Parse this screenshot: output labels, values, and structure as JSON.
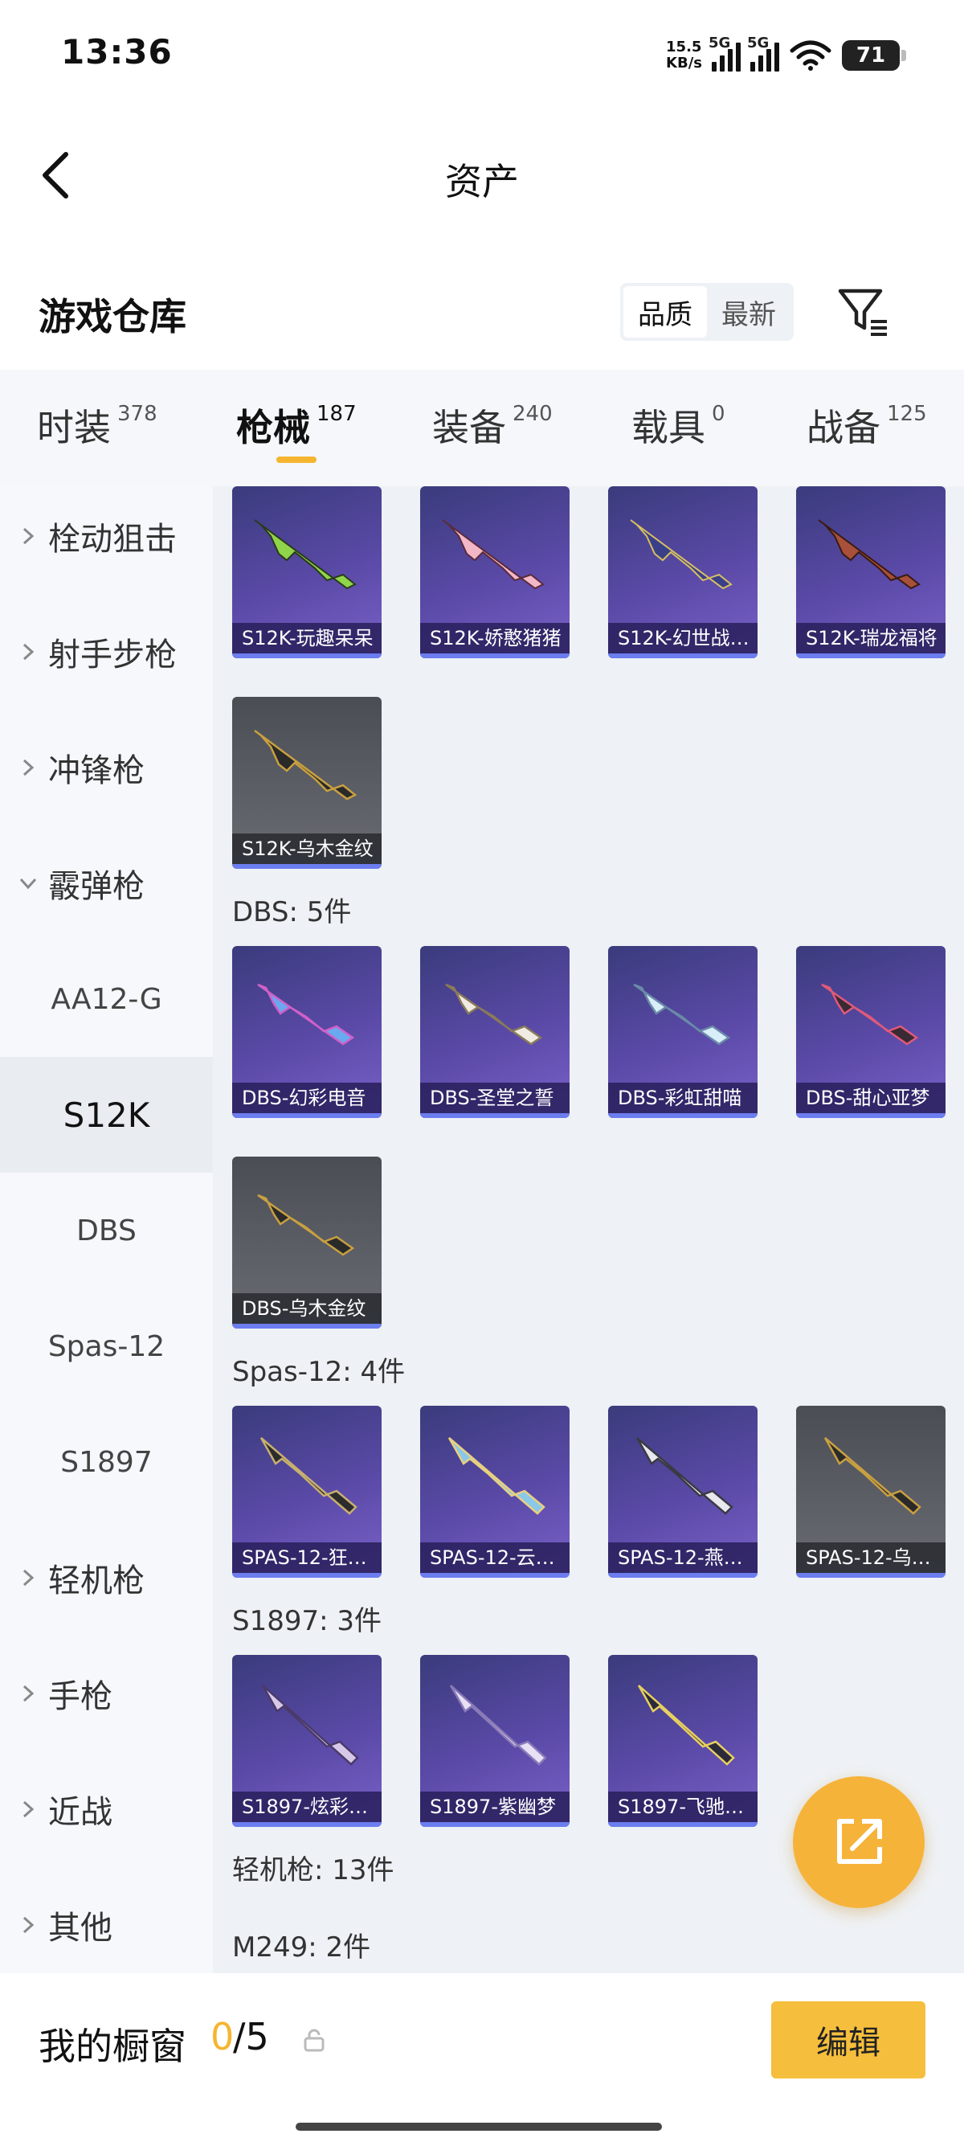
{
  "status_bar": {
    "time": "13:36",
    "net_speed_value": "15.5",
    "net_speed_unit": "KB/s",
    "signal1_label": "5G",
    "signal2_label": "5G",
    "battery": "71"
  },
  "header": {
    "title": "资产"
  },
  "warehouse": {
    "title": "游戏仓库",
    "sort_quality": "品质",
    "sort_latest": "最新",
    "active_sort": "品质"
  },
  "tabs": [
    {
      "label": "时装",
      "count": "378"
    },
    {
      "label": "枪械",
      "count": "187"
    },
    {
      "label": "装备",
      "count": "240"
    },
    {
      "label": "载具",
      "count": "0"
    },
    {
      "label": "战备",
      "count": "125"
    }
  ],
  "active_tab": "枪械",
  "sidebar": {
    "categories": [
      {
        "label": "栓动狙击"
      },
      {
        "label": "射手步枪"
      },
      {
        "label": "冲锋枪"
      },
      {
        "label": "霰弹枪"
      },
      {
        "label": "轻机枪"
      },
      {
        "label": "手枪"
      },
      {
        "label": "近战"
      },
      {
        "label": "其他"
      }
    ],
    "subitems": [
      {
        "label": "AA12-G"
      },
      {
        "label": "S12K"
      },
      {
        "label": "DBS"
      },
      {
        "label": "Spas-12"
      },
      {
        "label": "S1897"
      }
    ],
    "active_subitem": "S12K"
  },
  "sections": {
    "s12k": {
      "items": [
        "S12K-玩趣呆呆",
        "S12K-娇憨猪猪",
        "S12K-幻世战…",
        "S12K-瑞龙福将",
        "S12K-乌木金纹"
      ]
    },
    "dbs": {
      "label": "DBS: 5件",
      "items": [
        "DBS-幻彩电音",
        "DBS-圣堂之誓",
        "DBS-彩虹甜喵",
        "DBS-甜心亚梦",
        "DBS-乌木金纹"
      ]
    },
    "spas": {
      "label": "Spas-12: 4件",
      "items": [
        "SPAS-12-狂…",
        "SPAS-12-云…",
        "SPAS-12-燕…",
        "SPAS-12-乌…"
      ]
    },
    "s1897": {
      "label": "S1897: 3件",
      "items": [
        "S1897-炫彩…",
        "S1897-紫幽梦",
        "S1897-飞驰…"
      ]
    },
    "lmg_label": "轻机枪: 13件",
    "m249_label": "M249: 2件"
  },
  "bottom_bar": {
    "window_label": "我的橱窗",
    "count_used": "0",
    "count_total": "/5",
    "edit_label": "编辑"
  },
  "colors": {
    "accent": "#f5b530",
    "card_purple": "#5b4aa8",
    "card_gray": "#5e6068",
    "card_bar": "#6c7df0"
  },
  "icons": [
    "back-arrow-icon",
    "filter-icon",
    "chevron-right-icon",
    "chevron-down-icon",
    "share-icon",
    "lock-icon",
    "wifi-icon",
    "battery-icon"
  ]
}
